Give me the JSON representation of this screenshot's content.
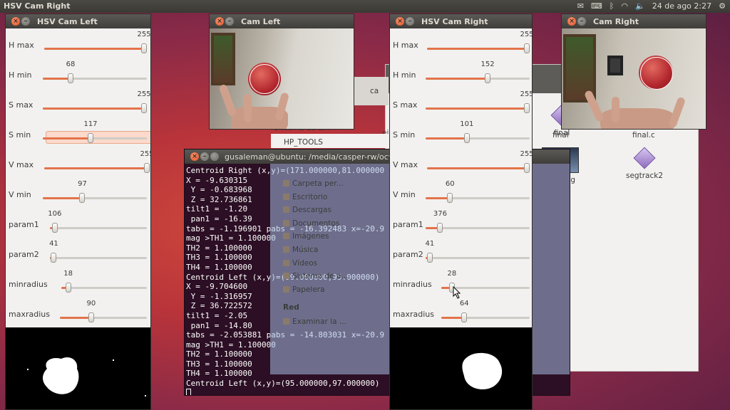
{
  "top_panel": {
    "app_title": "HSV Cam Right",
    "date_time": "24 de ago  2:27"
  },
  "hsv_left": {
    "title": "HSV Cam Left",
    "sliders": [
      {
        "label": "H max",
        "value": "255",
        "frac": 1.0
      },
      {
        "label": "H min",
        "value": "68",
        "frac": 0.267
      },
      {
        "label": "S max",
        "value": "255",
        "frac": 1.0
      },
      {
        "label": "S min",
        "value": "117",
        "frac": 0.459
      },
      {
        "label": "V max",
        "value": "255",
        "frac": 1.0
      },
      {
        "label": "V min",
        "value": "97",
        "frac": 0.38
      },
      {
        "label": "param1",
        "value": "106",
        "frac": 0.05
      },
      {
        "label": "param2",
        "value": "41",
        "frac": 0.04
      },
      {
        "label": "minradius",
        "value": "18",
        "frac": 0.08
      },
      {
        "label": "maxradius",
        "value": "90",
        "frac": 0.36
      }
    ]
  },
  "hsv_right": {
    "title": "HSV Cam Right",
    "sliders": [
      {
        "label": "H max",
        "value": "255",
        "frac": 1.0
      },
      {
        "label": "H min",
        "value": "152",
        "frac": 0.596
      },
      {
        "label": "S max",
        "value": "255",
        "frac": 1.0
      },
      {
        "label": "S min",
        "value": "101",
        "frac": 0.396
      },
      {
        "label": "V max",
        "value": "255",
        "frac": 1.0
      },
      {
        "label": "V min",
        "value": "60",
        "frac": 0.235
      },
      {
        "label": "param1",
        "value": "376",
        "frac": 0.14
      },
      {
        "label": "param2",
        "value": "41",
        "frac": 0.04
      },
      {
        "label": "minradius",
        "value": "28",
        "frac": 0.12
      },
      {
        "label": "maxradius",
        "value": "64",
        "frac": 0.26
      }
    ]
  },
  "cam_left": {
    "title": "Cam Left"
  },
  "cam_right": {
    "title": "Cam Right"
  },
  "terminal": {
    "title": "gusaleman@ubuntu: /media/casper-rw/ocv1",
    "lines": [
      "Centroid Right (x,y)=(171.000000,81.000000",
      "X = -9.630315",
      " Y = -0.683968",
      " Z = 32.736861",
      "tilt1 = -1.20",
      " pan1 = -16.39",
      "tabs = -1.196901 pabs = -16.392483 x=-20.9",
      "mag >TH1 = 1.100000",
      "TH2 = 1.100000",
      "TH3 = 1.100000",
      "TH4 = 1.100000",
      "Centroid Left (x,y)=(99.000000,95.000000)",
      "X = -9.704600",
      " Y = -1.316957",
      " Z = 36.722572",
      "tilt1 = -2.05",
      " pan1 = -14.80",
      "tabs = -2.053881 pabs = -14.803031 x=-20.9",
      "mag >TH1 = 1.100000",
      "TH2 = 1.100000",
      "TH3 = 1.100000",
      "TH4 = 1.100000",
      "Centroid Left (x,y)=(95.000000,97.000000)"
    ]
  },
  "file_manager": {
    "hp_tools": "HP_TOOLS",
    "sistema_top": "Sistema de a...",
    "places": [
      "Carpeta per...",
      "Escritorio",
      "Descargas",
      "Documentos",
      "Imágenes",
      "Música",
      "Vídeos",
      "Sistema de a...",
      "Papelera"
    ],
    "red_header": "Red",
    "examinar": "Examinar la ...",
    "files": [
      "final",
      "final.c",
      "hola.jpg",
      "segtrack2"
    ],
    "partial": [
      "eje",
      "ca",
      "fi",
      "seg"
    ]
  },
  "colors": {
    "accent": "#e3734a",
    "terminal_bg": "#2c0f24",
    "panel": "#3c3b37"
  }
}
